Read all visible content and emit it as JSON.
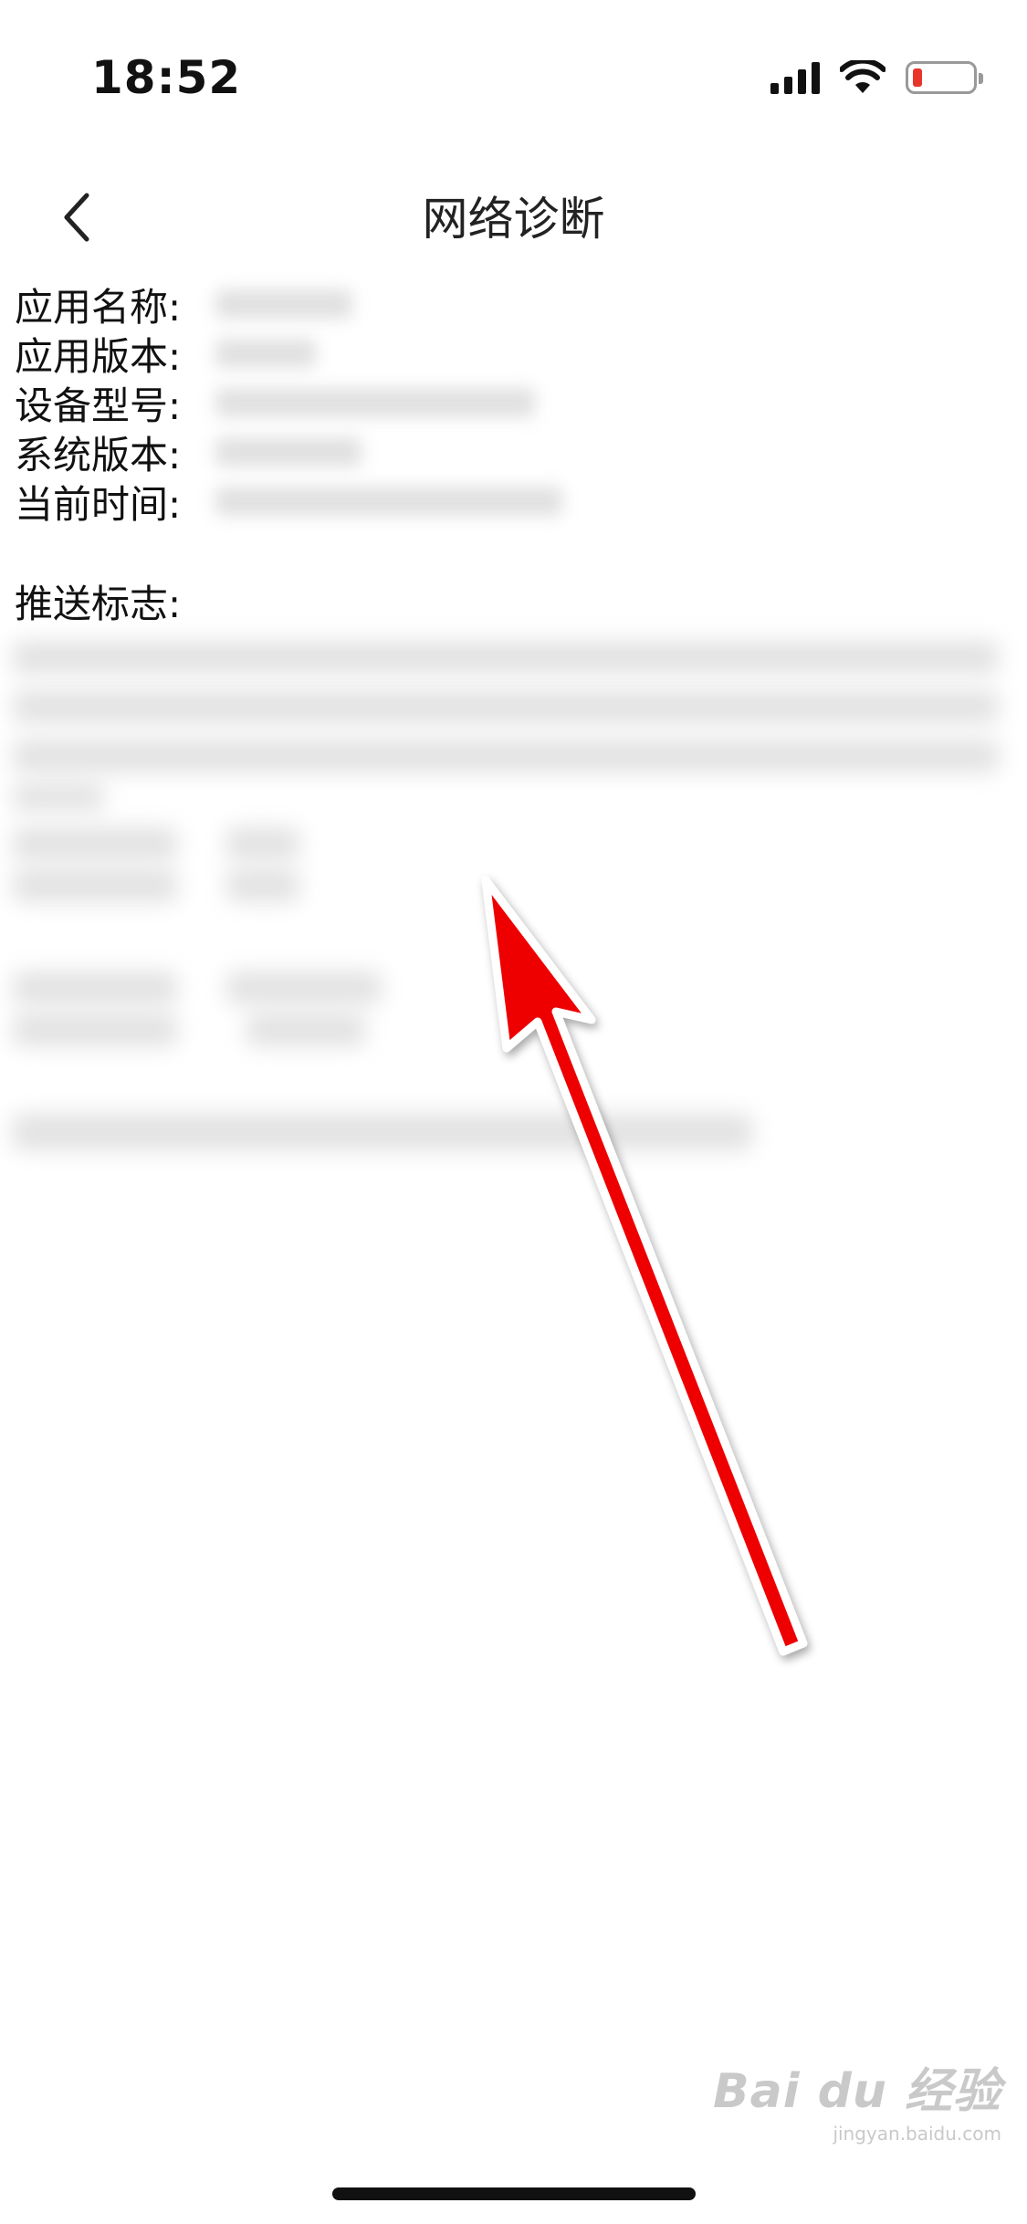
{
  "status_bar": {
    "time": "18:52",
    "icons": [
      "cellular-signal-icon",
      "wifi-icon",
      "battery-low-icon"
    ],
    "battery_color": "#e8352c"
  },
  "nav": {
    "back_icon": "chevron-left-icon",
    "title": "网络诊断"
  },
  "info": {
    "app_name_label": "应用名称:",
    "app_version_label": "应用版本:",
    "device_model_label": "设备型号:",
    "system_version_label": "系统版本:",
    "current_time_label": "当前时间:"
  },
  "push": {
    "label": "推送标志:"
  },
  "annotation": {
    "arrow_color": "#ee0000"
  },
  "watermark": {
    "main": "Bai du 经验",
    "sub": "jingyan.baidu.com"
  }
}
